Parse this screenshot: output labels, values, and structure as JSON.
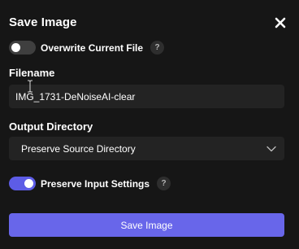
{
  "dialog": {
    "title": "Save Image",
    "close_icon": "close-icon"
  },
  "overwrite": {
    "label": "Overwrite Current File",
    "enabled": false,
    "help_glyph": "?"
  },
  "filename": {
    "label": "Filename",
    "value": "IMG_1731-DeNoiseAI-clear"
  },
  "output_directory": {
    "label": "Output Directory",
    "selected": "Preserve Source Directory",
    "dropdown_icon": "chevron-down-icon"
  },
  "preserve_input": {
    "label": "Preserve Input Settings",
    "enabled": true,
    "help_glyph": "?"
  },
  "actions": {
    "save_label": "Save Image"
  },
  "colors": {
    "background": "#161616",
    "field": "#232323",
    "accent": "#6866ea",
    "toggle_off": "#3f3f3f"
  }
}
